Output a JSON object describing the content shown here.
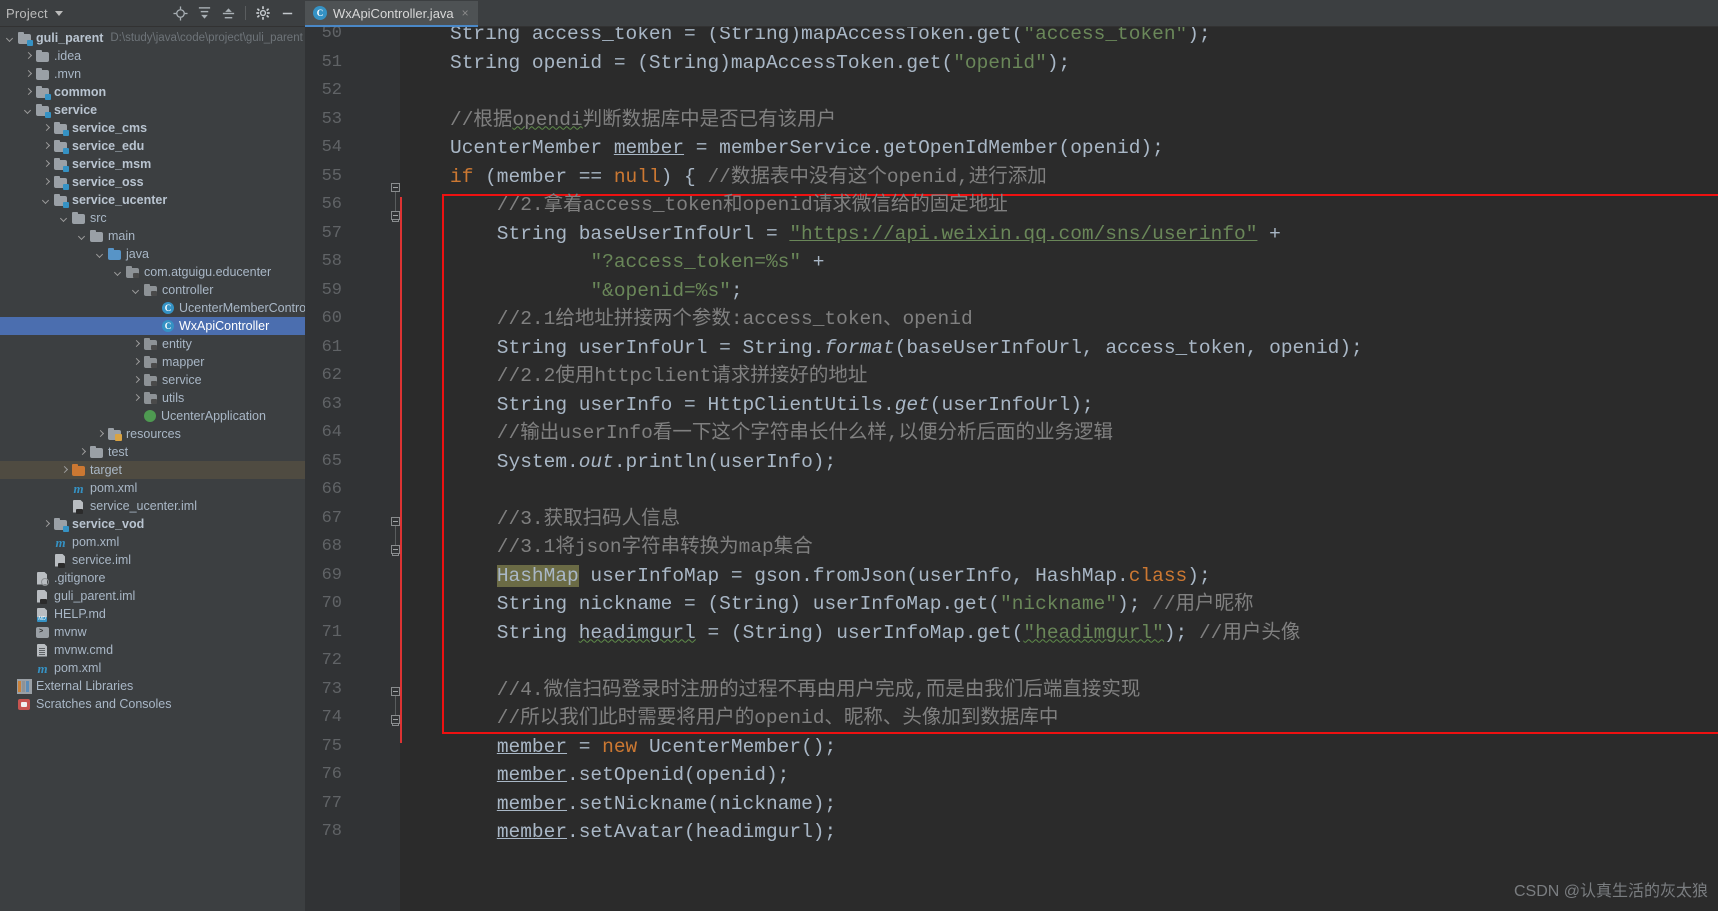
{
  "tool_window": {
    "title": "Project",
    "actions": [
      {
        "name": "locate-icon",
        "label": "Select Opened File"
      },
      {
        "name": "expand-all-icon",
        "label": "Expand All"
      },
      {
        "name": "collapse-all-icon",
        "label": "Collapse All"
      },
      {
        "name": "gear-icon",
        "label": "Settings"
      },
      {
        "name": "minimize-icon",
        "label": "Hide"
      }
    ]
  },
  "editor_tabs": [
    {
      "label": "WxApiController.java",
      "icon": "java-class-icon",
      "active": true,
      "close": "×"
    }
  ],
  "project_tree": [
    {
      "depth": 0,
      "arrow": "open",
      "icon": "module-folder",
      "label": "guli_parent",
      "bold": true,
      "path": "D:\\study\\java\\code\\project\\guli_parent"
    },
    {
      "depth": 1,
      "arrow": "closed",
      "icon": "folder",
      "label": ".idea"
    },
    {
      "depth": 1,
      "arrow": "closed",
      "icon": "folder",
      "label": ".mvn"
    },
    {
      "depth": 1,
      "arrow": "closed",
      "icon": "module-folder",
      "label": "common",
      "bold": true
    },
    {
      "depth": 1,
      "arrow": "open",
      "icon": "module-folder",
      "label": "service",
      "bold": true
    },
    {
      "depth": 2,
      "arrow": "closed",
      "icon": "module-folder",
      "label": "service_cms",
      "bold": true
    },
    {
      "depth": 2,
      "arrow": "closed",
      "icon": "module-folder",
      "label": "service_edu",
      "bold": true
    },
    {
      "depth": 2,
      "arrow": "closed",
      "icon": "module-folder",
      "label": "service_msm",
      "bold": true
    },
    {
      "depth": 2,
      "arrow": "closed",
      "icon": "module-folder",
      "label": "service_oss",
      "bold": true
    },
    {
      "depth": 2,
      "arrow": "open",
      "icon": "module-folder",
      "label": "service_ucenter",
      "bold": true
    },
    {
      "depth": 3,
      "arrow": "open",
      "icon": "folder",
      "label": "src"
    },
    {
      "depth": 4,
      "arrow": "open",
      "icon": "folder",
      "label": "main"
    },
    {
      "depth": 5,
      "arrow": "open",
      "icon": "source-folder",
      "label": "java"
    },
    {
      "depth": 6,
      "arrow": "open",
      "icon": "package",
      "label": "com.atguigu.educenter"
    },
    {
      "depth": 7,
      "arrow": "open",
      "icon": "package",
      "label": "controller"
    },
    {
      "depth": 8,
      "arrow": "none",
      "icon": "java-class",
      "label": "UcenterMemberController"
    },
    {
      "depth": 8,
      "arrow": "none",
      "icon": "java-class",
      "label": "WxApiController",
      "selected": true
    },
    {
      "depth": 7,
      "arrow": "closed",
      "icon": "package",
      "label": "entity"
    },
    {
      "depth": 7,
      "arrow": "closed",
      "icon": "package",
      "label": "mapper"
    },
    {
      "depth": 7,
      "arrow": "closed",
      "icon": "package",
      "label": "service"
    },
    {
      "depth": 7,
      "arrow": "closed",
      "icon": "package",
      "label": "utils"
    },
    {
      "depth": 7,
      "arrow": "none",
      "icon": "spring-class",
      "label": "UcenterApplication"
    },
    {
      "depth": 5,
      "arrow": "closed",
      "icon": "resource-folder",
      "label": "resources"
    },
    {
      "depth": 4,
      "arrow": "closed",
      "icon": "folder",
      "label": "test"
    },
    {
      "depth": 3,
      "arrow": "closed",
      "icon": "excluded-folder",
      "label": "target",
      "excluded": true
    },
    {
      "depth": 3,
      "arrow": "none",
      "icon": "maven-file",
      "label": "pom.xml"
    },
    {
      "depth": 3,
      "arrow": "none",
      "icon": "iml-file",
      "label": "service_ucenter.iml"
    },
    {
      "depth": 2,
      "arrow": "closed",
      "icon": "module-folder",
      "label": "service_vod",
      "bold": true
    },
    {
      "depth": 2,
      "arrow": "none",
      "icon": "maven-file",
      "label": "pom.xml"
    },
    {
      "depth": 2,
      "arrow": "none",
      "icon": "iml-file",
      "label": "service.iml"
    },
    {
      "depth": 1,
      "arrow": "none",
      "icon": "gitignore-file",
      "label": ".gitignore"
    },
    {
      "depth": 1,
      "arrow": "none",
      "icon": "iml-file",
      "label": "guli_parent.iml"
    },
    {
      "depth": 1,
      "arrow": "none",
      "icon": "markdown-file",
      "label": "HELP.md"
    },
    {
      "depth": 1,
      "arrow": "none",
      "icon": "terminal-file",
      "label": "mvnw"
    },
    {
      "depth": 1,
      "arrow": "none",
      "icon": "cmd-file",
      "label": "mvnw.cmd"
    },
    {
      "depth": 1,
      "arrow": "none",
      "icon": "maven-file",
      "label": "pom.xml"
    },
    {
      "depth": 0,
      "arrow": "none",
      "icon": "libraries",
      "label": "External Libraries"
    },
    {
      "depth": 0,
      "arrow": "none",
      "icon": "scratches",
      "label": "Scratches and Consoles"
    }
  ],
  "editor": {
    "first_line_number": 50,
    "line_numbers": [
      50,
      51,
      52,
      53,
      54,
      55,
      56,
      57,
      58,
      59,
      60,
      61,
      62,
      63,
      64,
      65,
      66,
      67,
      68,
      69,
      70,
      71,
      72,
      73,
      74,
      75,
      76,
      77,
      78
    ],
    "lines": [
      {
        "n": 50,
        "segments": [
          {
            "t": "String access_token = (String)mapAccessToken.get(",
            "c": ""
          },
          {
            "t": "\"access_token\"",
            "c": "str"
          },
          {
            "t": ");",
            "c": ""
          }
        ]
      },
      {
        "n": 51,
        "segments": [
          {
            "t": "String openid = (String)mapAccessToken.get(",
            "c": ""
          },
          {
            "t": "\"openid\"",
            "c": "str"
          },
          {
            "t": ");",
            "c": ""
          }
        ]
      },
      {
        "n": 52,
        "segments": []
      },
      {
        "n": 53,
        "segments": [
          {
            "t": "//根据",
            "c": "cmt"
          },
          {
            "t": "opendi",
            "c": "cmt typo"
          },
          {
            "t": "判断数据库中是否已有该用户",
            "c": "cmt"
          }
        ]
      },
      {
        "n": 54,
        "segments": [
          {
            "t": "UcenterMember ",
            "c": ""
          },
          {
            "t": "member",
            "c": "uline"
          },
          {
            "t": " = memberService.getOpenIdMember(openid);",
            "c": ""
          }
        ]
      },
      {
        "n": 55,
        "segments": [
          {
            "t": "if",
            "c": "kw"
          },
          {
            "t": " (member == ",
            "c": ""
          },
          {
            "t": "null",
            "c": "kw"
          },
          {
            "t": ") { ",
            "c": ""
          },
          {
            "t": "//数据表中没有这个openid,进行添加",
            "c": "cmt"
          }
        ]
      },
      {
        "n": 56,
        "segments": [
          {
            "t": "    //2.拿着access_token和openid请求微信给的固定地址",
            "c": "cmt"
          }
        ]
      },
      {
        "n": 57,
        "segments": [
          {
            "t": "    String baseUserInfoUrl = ",
            "c": ""
          },
          {
            "t": "\"https://api.weixin.qq.com/sns/userinfo\"",
            "c": "lnk"
          },
          {
            "t": " +",
            "c": ""
          }
        ]
      },
      {
        "n": 58,
        "segments": [
          {
            "t": "            ",
            "c": ""
          },
          {
            "t": "\"?access_token=%s\"",
            "c": "str"
          },
          {
            "t": " +",
            "c": ""
          }
        ]
      },
      {
        "n": 59,
        "segments": [
          {
            "t": "            ",
            "c": ""
          },
          {
            "t": "\"&openid=%s\"",
            "c": "str"
          },
          {
            "t": ";",
            "c": ""
          }
        ]
      },
      {
        "n": 60,
        "segments": [
          {
            "t": "    //2.1给地址拼接两个参数:access_token、openid",
            "c": "cmt"
          }
        ]
      },
      {
        "n": 61,
        "segments": [
          {
            "t": "    String userInfoUrl = String.",
            "c": ""
          },
          {
            "t": "format",
            "c": "stat"
          },
          {
            "t": "(baseUserInfoUrl, access_token, openid);",
            "c": ""
          }
        ]
      },
      {
        "n": 62,
        "segments": [
          {
            "t": "    //2.2使用httpclient请求拼接好的地址",
            "c": "cmt"
          }
        ]
      },
      {
        "n": 63,
        "segments": [
          {
            "t": "    String userInfo = HttpClientUtils.",
            "c": ""
          },
          {
            "t": "get",
            "c": "stat"
          },
          {
            "t": "(userInfoUrl);",
            "c": ""
          }
        ]
      },
      {
        "n": 64,
        "segments": [
          {
            "t": "    //输出userInfo看一下这个字符串长什么样,以便分析后面的业务逻辑",
            "c": "cmt"
          }
        ]
      },
      {
        "n": 65,
        "segments": [
          {
            "t": "    System.",
            "c": ""
          },
          {
            "t": "out",
            "c": "stat"
          },
          {
            "t": ".println(userInfo);",
            "c": ""
          }
        ]
      },
      {
        "n": 66,
        "segments": []
      },
      {
        "n": 67,
        "segments": [
          {
            "t": "    //3.获取扫码人信息",
            "c": "cmt"
          }
        ]
      },
      {
        "n": 68,
        "segments": [
          {
            "t": "    //3.1将json字符串转换为map集合",
            "c": "cmt"
          }
        ]
      },
      {
        "n": 69,
        "segments": [
          {
            "t": "    ",
            "c": ""
          },
          {
            "t": "HashMap",
            "c": "hl"
          },
          {
            "t": " userInfoMap = gson.fromJson(userInfo, HashMap.",
            "c": ""
          },
          {
            "t": "class",
            "c": "kw"
          },
          {
            "t": ");",
            "c": ""
          }
        ]
      },
      {
        "n": 70,
        "segments": [
          {
            "t": "    String nickname = (String) userInfoMap.get(",
            "c": ""
          },
          {
            "t": "\"nickname\"",
            "c": "str"
          },
          {
            "t": "); ",
            "c": ""
          },
          {
            "t": "//用户昵称",
            "c": "cmt"
          }
        ]
      },
      {
        "n": 71,
        "segments": [
          {
            "t": "    String ",
            "c": ""
          },
          {
            "t": "headimgurl",
            "c": "typo"
          },
          {
            "t": " = (String) userInfoMap.get(",
            "c": ""
          },
          {
            "t": "\"headimgurl\"",
            "c": "str typo"
          },
          {
            "t": "); ",
            "c": ""
          },
          {
            "t": "//用户头像",
            "c": "cmt"
          }
        ]
      },
      {
        "n": 72,
        "segments": []
      },
      {
        "n": 73,
        "segments": [
          {
            "t": "    //4.微信扫码登录时注册的过程不再由用户完成,而是由我们后端直接实现",
            "c": "cmt"
          }
        ]
      },
      {
        "n": 74,
        "segments": [
          {
            "t": "    //所以我们此时需要将用户的openid、昵称、头像加到数据库中",
            "c": "cmt"
          }
        ]
      },
      {
        "n": 75,
        "segments": [
          {
            "t": "    ",
            "c": ""
          },
          {
            "t": "member",
            "c": "uline"
          },
          {
            "t": " = ",
            "c": ""
          },
          {
            "t": "new",
            "c": "kw"
          },
          {
            "t": " UcenterMember();",
            "c": ""
          }
        ]
      },
      {
        "n": 76,
        "segments": [
          {
            "t": "    ",
            "c": ""
          },
          {
            "t": "member",
            "c": "uline"
          },
          {
            "t": ".setOpenid(openid);",
            "c": ""
          }
        ]
      },
      {
        "n": 77,
        "segments": [
          {
            "t": "    ",
            "c": ""
          },
          {
            "t": "member",
            "c": "uline"
          },
          {
            "t": ".setNickname(nickname);",
            "c": ""
          }
        ]
      },
      {
        "n": 78,
        "segments": [
          {
            "t": "    ",
            "c": ""
          },
          {
            "t": "member",
            "c": "uline"
          },
          {
            "t": ".setAvatar(headimgurl);",
            "c": ""
          }
        ]
      }
    ],
    "annotation_box": {
      "color": "#ee1111",
      "covers_lines": "56-74"
    }
  },
  "watermark": "CSDN @认真生活的灰太狼",
  "colors": {
    "panel_bg": "#3c3f41",
    "editor_bg": "#2b2b2b",
    "gutter_bg": "#313335",
    "selection": "#4b6eaf",
    "excluded": "#4f4b41",
    "string": "#6a8759",
    "keyword": "#cc7832",
    "comment": "#808080",
    "text": "#a9b7c6",
    "accent": "#3592c4",
    "annotation": "#ee1111"
  }
}
